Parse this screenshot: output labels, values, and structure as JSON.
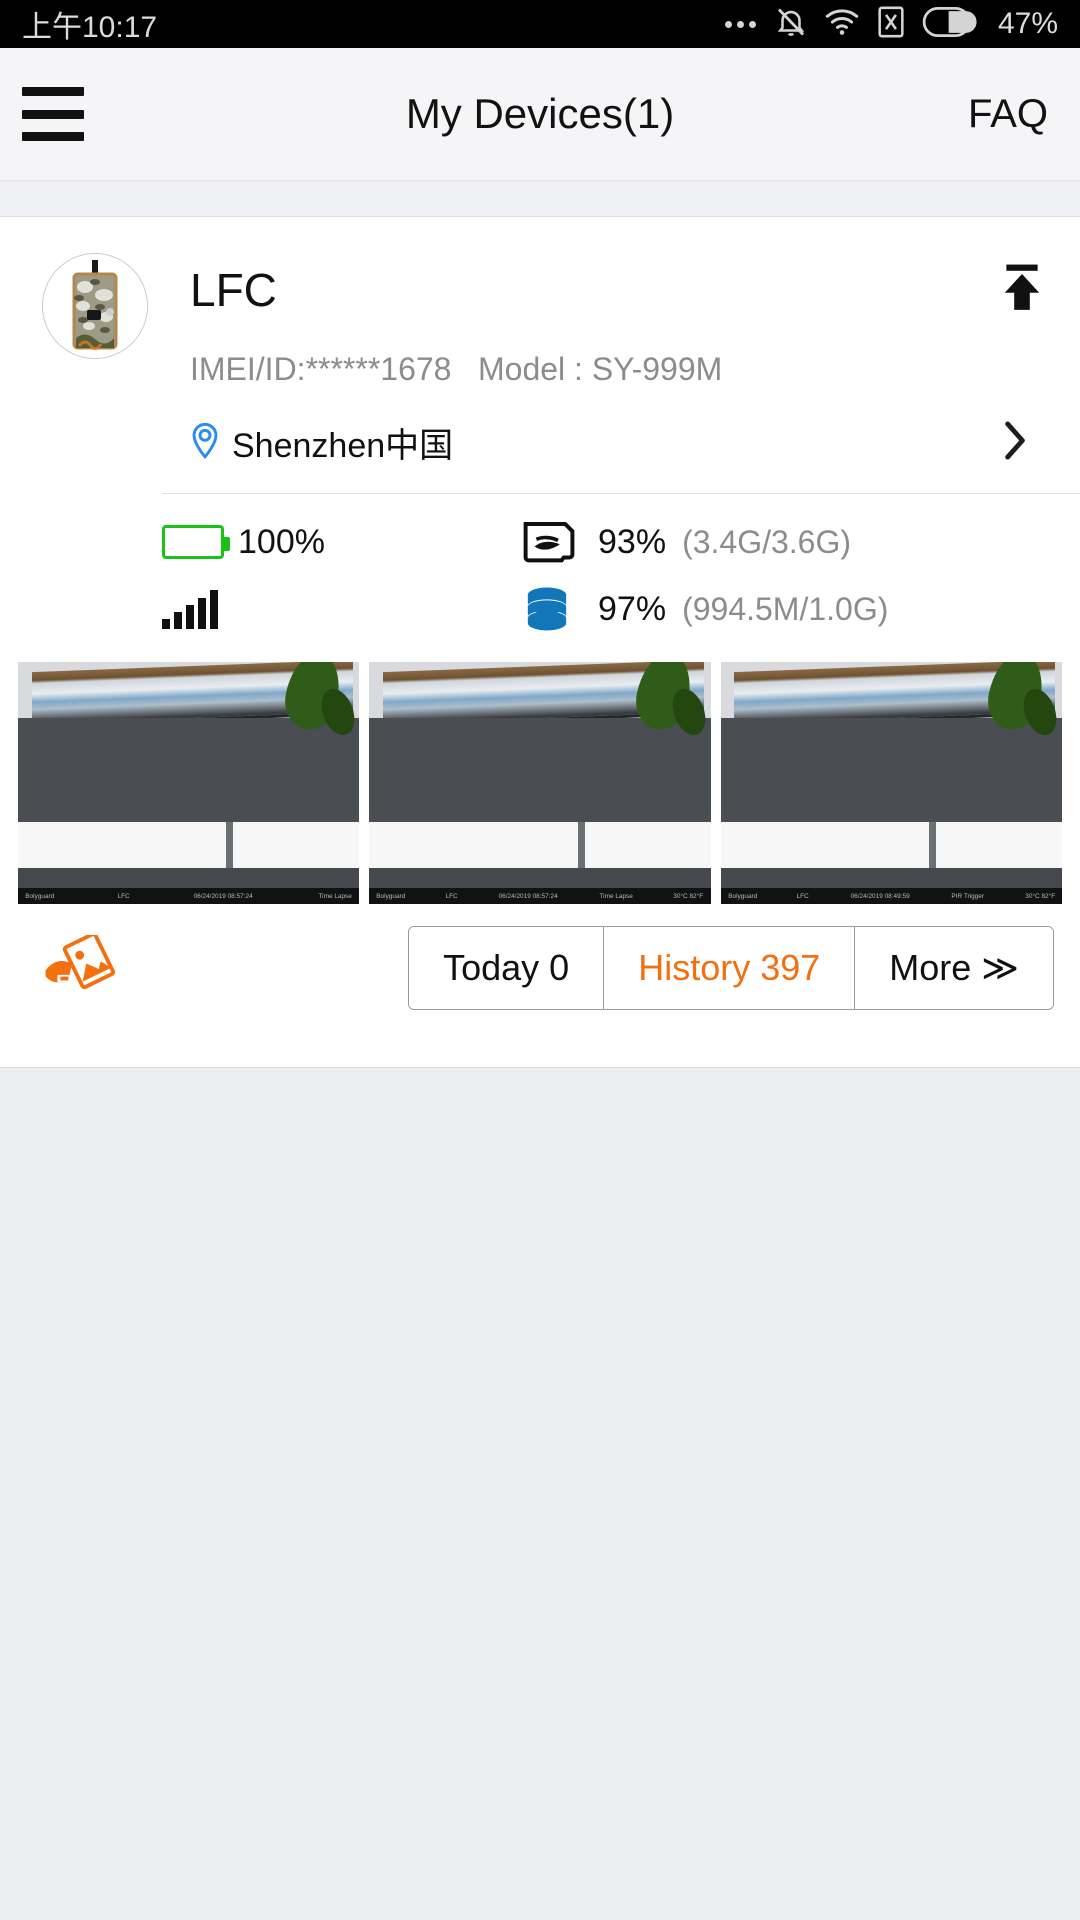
{
  "status_bar": {
    "time": "上午10:17",
    "battery_percent": "47%",
    "icons": [
      "more-dots-icon",
      "bell-muted-icon",
      "wifi-icon",
      "sim-x-icon",
      "battery-icon"
    ]
  },
  "app_bar": {
    "menu_icon": "hamburger-menu-icon",
    "title": "My Devices(1)",
    "faq_label": "FAQ"
  },
  "device": {
    "avatar_icon": "trail-camera-avatar",
    "name": "LFC",
    "upload_icon": "upload-icon",
    "imei_label": "IMEI/ID:******1678",
    "model_label": "Model : SY-999M",
    "location_icon": "location-pin-icon",
    "location_text": "Shenzhen中国",
    "chevron_icon": "chevron-right-icon",
    "stats": {
      "battery": {
        "icon": "battery-icon",
        "value": "100%",
        "detail": "",
        "fill_percent": 100,
        "color": "#18c217"
      },
      "sd_card": {
        "icon": "sd-card-icon",
        "value": "93%",
        "detail": "(3.4G/3.6G)"
      },
      "signal": {
        "icon": "signal-bars-icon",
        "value": "",
        "detail": "",
        "bars": 5
      },
      "data_storage": {
        "icon": "database-icon",
        "value": "97%",
        "detail": "(994.5M/1.0G)",
        "color": "#1177b8"
      }
    }
  },
  "thumbnails": [
    {
      "name": "thumbnail-1",
      "overlay": {
        "brand": "Bolyguard",
        "device": "LFC",
        "datetime": "06/24/2019 08:57:24",
        "mode": "Time Lapse",
        "temp": ""
      }
    },
    {
      "name": "thumbnail-2",
      "overlay": {
        "brand": "Bolyguard",
        "device": "LFC",
        "datetime": "06/24/2019 08:57:24",
        "mode": "Time Lapse",
        "temp": "30°C 82°F"
      }
    },
    {
      "name": "thumbnail-3",
      "overlay": {
        "brand": "Bolyguard",
        "device": "LFC",
        "datetime": "06/24/2019 08:49:59",
        "mode": "PIR Trigger",
        "temp": "30°C 82°F"
      }
    }
  ],
  "actions": {
    "gallery_icon": "photo-hand-icon",
    "today_label": "Today 0",
    "history_label": "History 397",
    "more_label": "More ≫",
    "accent_color": "#f4700f"
  }
}
